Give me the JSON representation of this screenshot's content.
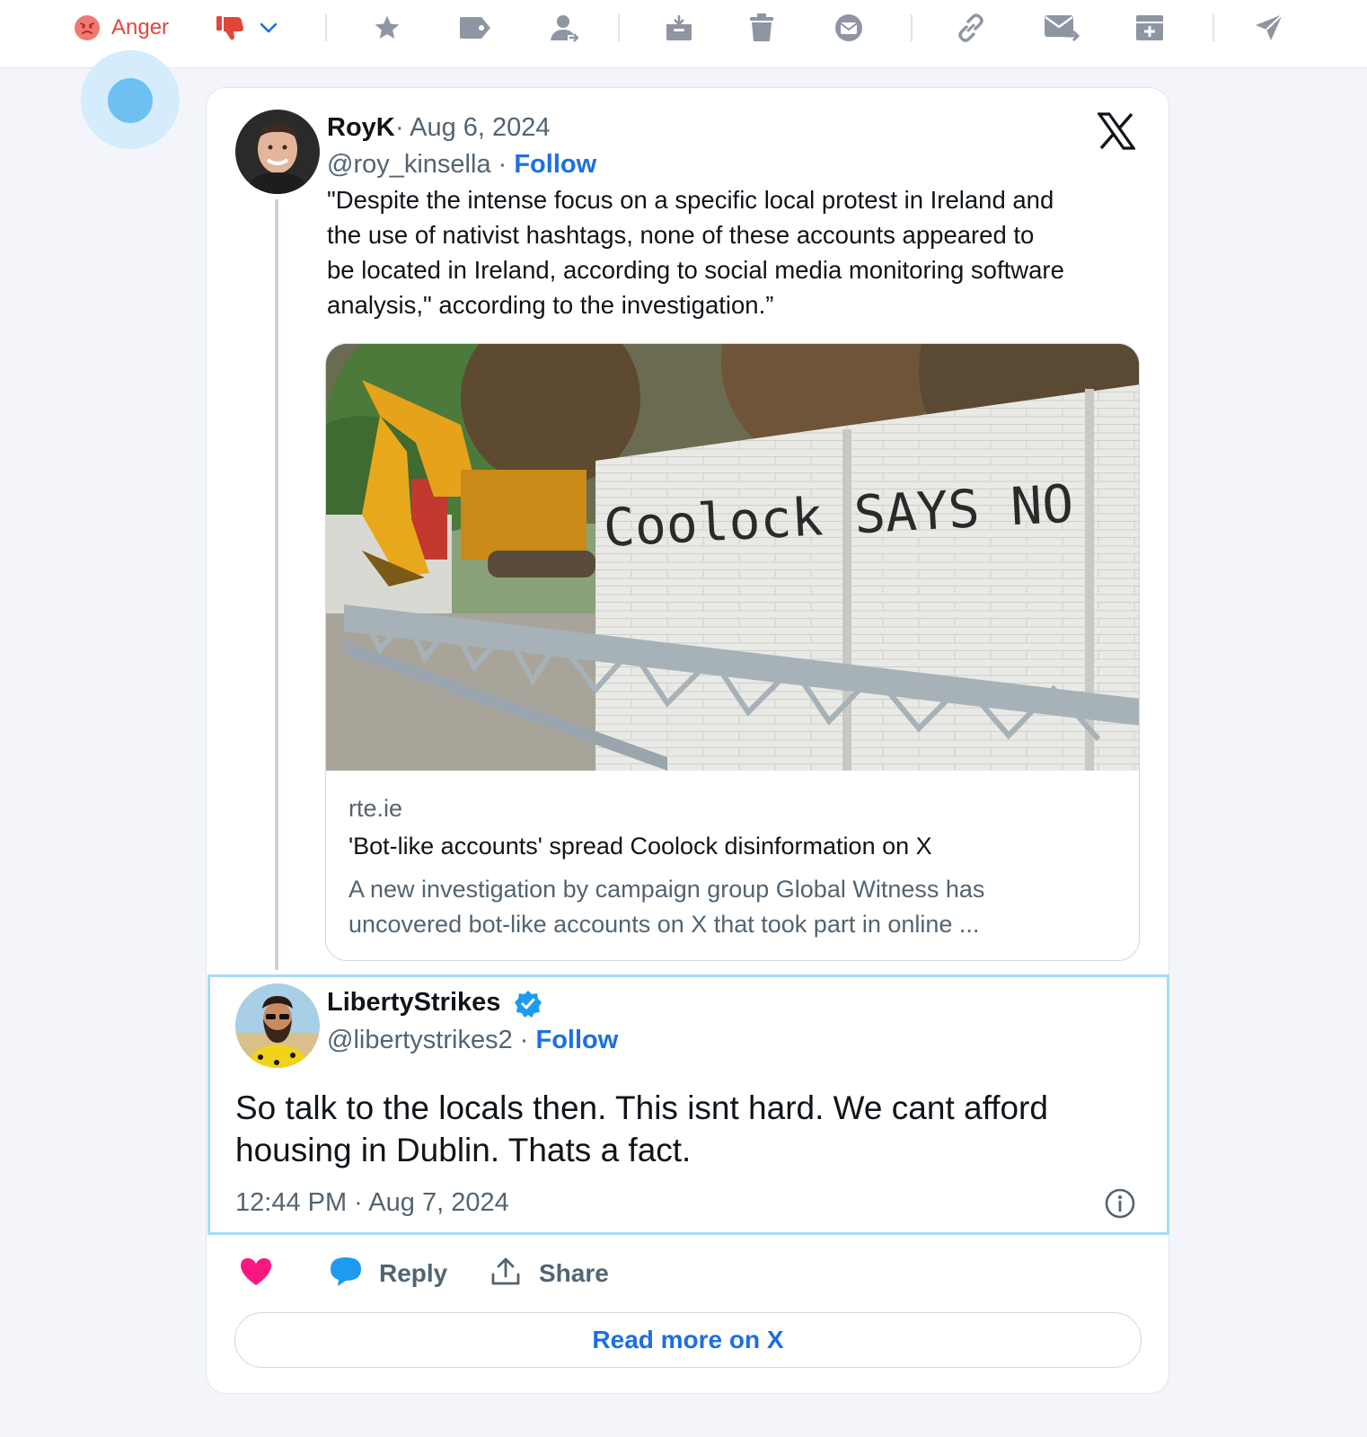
{
  "toolbar": {
    "sentiment_label": "Anger",
    "icons": [
      "angry-face-icon",
      "thumbs-down-icon",
      "chevron-down-icon",
      "star-icon",
      "tag-icon",
      "assign-user-icon",
      "archive-in-icon",
      "trash-icon",
      "mail-open-icon",
      "link-icon",
      "forward-mail-icon",
      "add-box-icon",
      "send-icon"
    ],
    "accent_color": "#e2453a"
  },
  "original_tweet": {
    "author_name": "RoyK",
    "date": "· Aug 6, 2024",
    "handle": "@roy_kinsella ·",
    "follow_label": "Follow",
    "text_lines": [
      "\"Despite the intense focus on a specific local protest in Ireland and",
      "the use of nativist hashtags, none of these accounts appeared to",
      "be located in Ireland, according to social media monitoring software",
      "analysis,\" according to the investigation.”"
    ],
    "link_card": {
      "domain": "rte.ie",
      "title": "'Bot-like accounts' spread Coolock disinformation on X",
      "description_lines": [
        "A new investigation by campaign group Global Witness has",
        "uncovered bot-like accounts on X that took part in online ..."
      ],
      "image_graffiti": "Coolock SAYS NO"
    }
  },
  "reply_tweet": {
    "author_name": "LibertyStrikes",
    "verified": true,
    "handle": "@libertystrikes2 ·",
    "follow_label": "Follow",
    "text_lines": [
      "So talk to the locals then. This isnt hard. We cant afford",
      "housing in Dublin. Thats a fact."
    ],
    "timestamp": "12:44 PM · Aug 7, 2024"
  },
  "actions": {
    "reply_label": "Reply",
    "share_label": "Share",
    "read_more_label": "Read more on X"
  },
  "colors": {
    "link_blue": "#1d6fe0",
    "like_pink": "#f91880",
    "reply_blue": "#1d9bf0",
    "selection_border": "#a6dcf7"
  }
}
